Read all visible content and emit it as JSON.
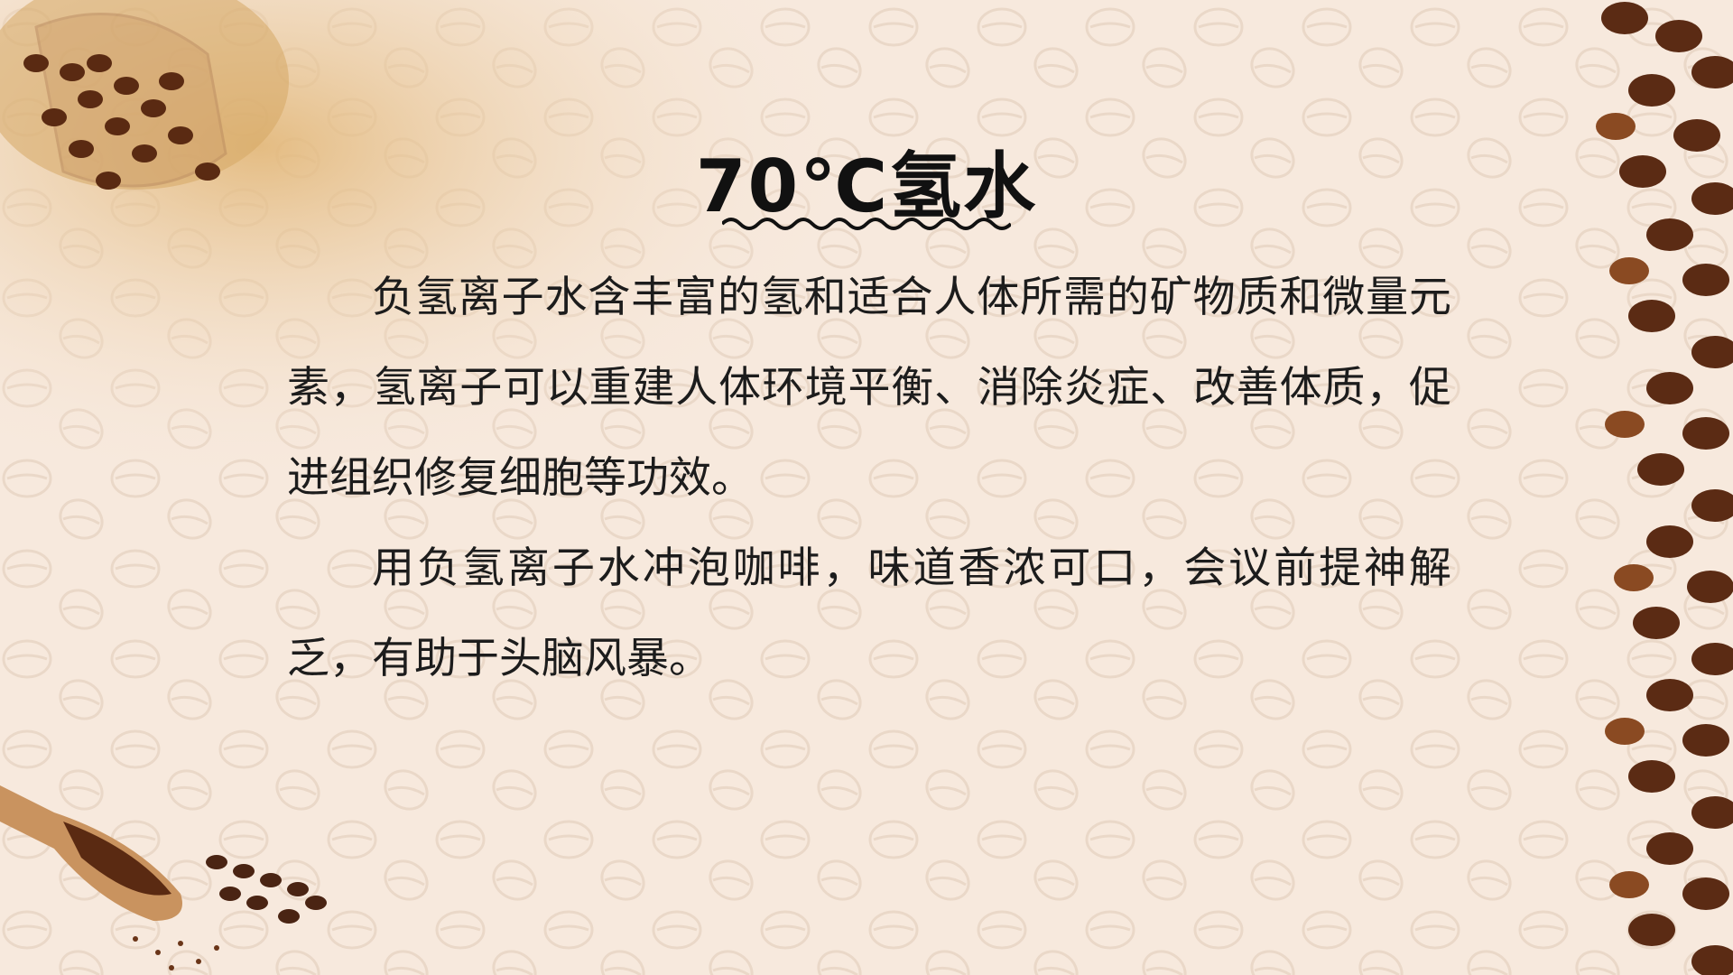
{
  "slide": {
    "title": "70℃氢水",
    "paragraphs": [
      "负氢离子水含丰富的氢和适合人体所需的矿物质和微量元素，氢离子可以重建人体环境平衡、消除炎症、改善体质，促进组织修复细胞等功效。",
      "用负氢离子水冲泡咖啡，味道香浓可口，会议前提神解乏，有助于头脑风暴。"
    ]
  },
  "colors": {
    "background": "#f7e9dd",
    "pattern": "#e8d5c4",
    "coffee_dark": "#4a2413",
    "coffee_mid": "#7a3f1c",
    "text": "#1c1c1c"
  }
}
